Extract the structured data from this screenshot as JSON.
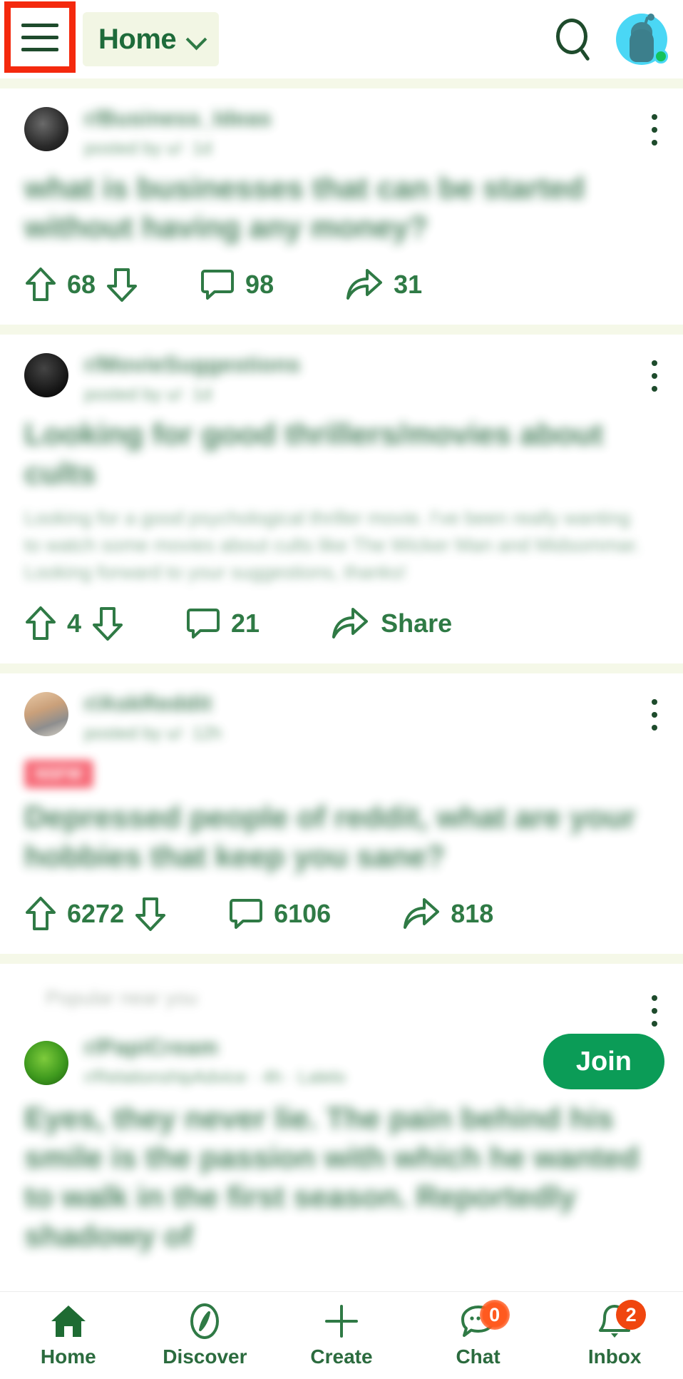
{
  "header": {
    "menu_icon": "hamburger-menu-icon",
    "title": "Home",
    "chevron_icon": "chevron-down-icon",
    "search_icon": "search-icon",
    "avatar_icon": "user-avatar"
  },
  "feed": {
    "posts": [
      {
        "subreddit": "r/Business_Ideas",
        "meta": "posted by u/·  1d",
        "title": "what is businesses that can be started without having any money?",
        "body": "",
        "nsfw": "",
        "avatar_style": "dark",
        "upvotes": "68",
        "comments": "98",
        "shares": "31"
      },
      {
        "subreddit": "r/MovieSuggestions",
        "meta": "posted by u/·  1d",
        "title": "Looking for good thrillers/movies about cults",
        "body": "Looking for a good psychological thriller movie. I've been really wanting to watch some movies about cults like The Wicker Man and Midsommar. Looking forward to your suggestions, thanks!",
        "nsfw": "",
        "avatar_style": "black",
        "upvotes": "4",
        "comments": "21",
        "shares": "Share"
      },
      {
        "subreddit": "r/AskReddit",
        "meta": "posted by u/·  12h",
        "title": "Depressed people of reddit, what are your hobbies that keep you sane?",
        "body": "",
        "nsfw": "NSFW",
        "avatar_style": "person",
        "upvotes": "6272",
        "comments": "6106",
        "shares": "818"
      }
    ]
  },
  "popular_card": {
    "label": "Popular near you",
    "subreddit": "r/PapiCream",
    "meta": "r/RelationshipAdvice · 4h · Lalelo",
    "join_label": "Join",
    "title": "Eyes, they never lie. The pain behind his smile is the passion with which he wanted to walk in the first season. Reportedly shadowy of"
  },
  "bottom_nav": {
    "items": [
      {
        "label": "Home",
        "icon": "home-icon",
        "badge": ""
      },
      {
        "label": "Discover",
        "icon": "compass-icon",
        "badge": ""
      },
      {
        "label": "Create",
        "icon": "plus-icon",
        "badge": ""
      },
      {
        "label": "Chat",
        "icon": "chat-bubble-icon",
        "badge": "0"
      },
      {
        "label": "Inbox",
        "icon": "bell-icon",
        "badge": "2"
      }
    ]
  },
  "colors": {
    "accent_green": "#2f7a45",
    "join_green": "#0b9c57",
    "badge_orange": "#f0460f",
    "highlight_red": "#f4290d",
    "chip_bg": "#f2f6e4"
  }
}
